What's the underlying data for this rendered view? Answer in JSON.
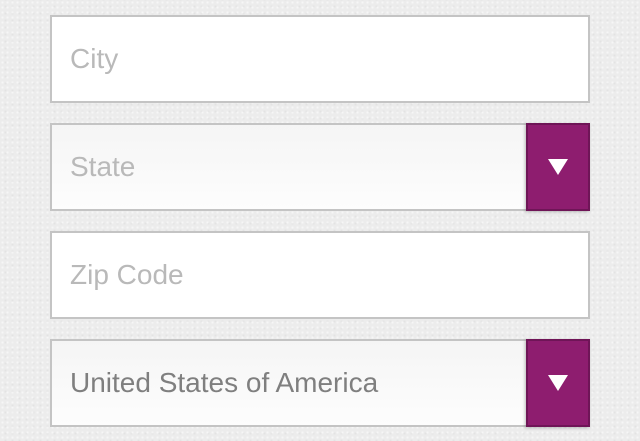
{
  "form": {
    "city": {
      "placeholder": "City",
      "value": ""
    },
    "state": {
      "placeholder": "State",
      "value": ""
    },
    "zip": {
      "placeholder": "Zip Code",
      "value": ""
    },
    "country": {
      "value": "United States of America"
    }
  },
  "icons": {
    "dropdown": "triangle-down-icon"
  },
  "colors": {
    "accent": "#8e1d6f",
    "border": "#c4c4c4",
    "placeholder": "#b9b9b9",
    "value_text": "#7f7f7f",
    "background": "#ececec"
  }
}
